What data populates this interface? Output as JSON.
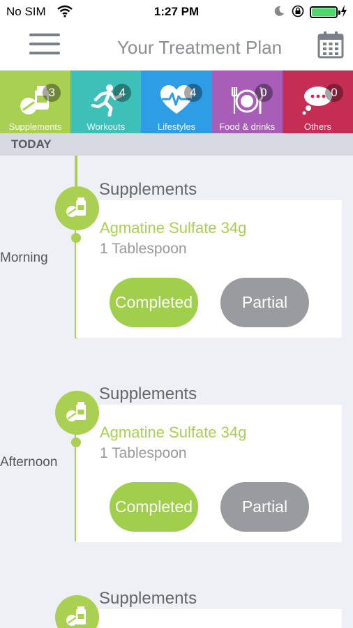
{
  "status_bar": {
    "carrier": "No SIM",
    "time": "1:27 PM"
  },
  "header": {
    "title": "Your Treatment Plan",
    "menu_icon": "hamburger-menu-icon",
    "calendar_icon": "calendar-icon"
  },
  "tabs": [
    {
      "label": "Supplements",
      "count": "3",
      "color": "#a9cf53",
      "icon": "pills-icon"
    },
    {
      "label": "Workouts",
      "count": "4",
      "color": "#3ebfb8",
      "icon": "running-person-icon"
    },
    {
      "label": "Lifestyles",
      "count": "4",
      "color": "#2d9de6",
      "icon": "heart-pulse-icon"
    },
    {
      "label": "Food & drinks",
      "count": "0",
      "color": "#a85db6",
      "icon": "plate-fork-knife-icon"
    },
    {
      "label": "Others",
      "count": "0",
      "color": "#c52d55",
      "icon": "thought-bubble-icon"
    }
  ],
  "today_label": "TODAY",
  "timeline": [
    {
      "time": "Morning",
      "category": "Supplements",
      "item": "Agmatine Sulfate 34g",
      "dose": "1 Tablespoon",
      "completed_label": "Completed",
      "partial_label": "Partial"
    },
    {
      "time": "Afternoon",
      "category": "Supplements",
      "item": "Agmatine Sulfate 34g",
      "dose": "1 Tablespoon",
      "completed_label": "Completed",
      "partial_label": "Partial"
    },
    {
      "category": "Supplements"
    }
  ],
  "colors": {
    "accent_green": "#a9cf53",
    "partial_gray": "#999b9e"
  }
}
